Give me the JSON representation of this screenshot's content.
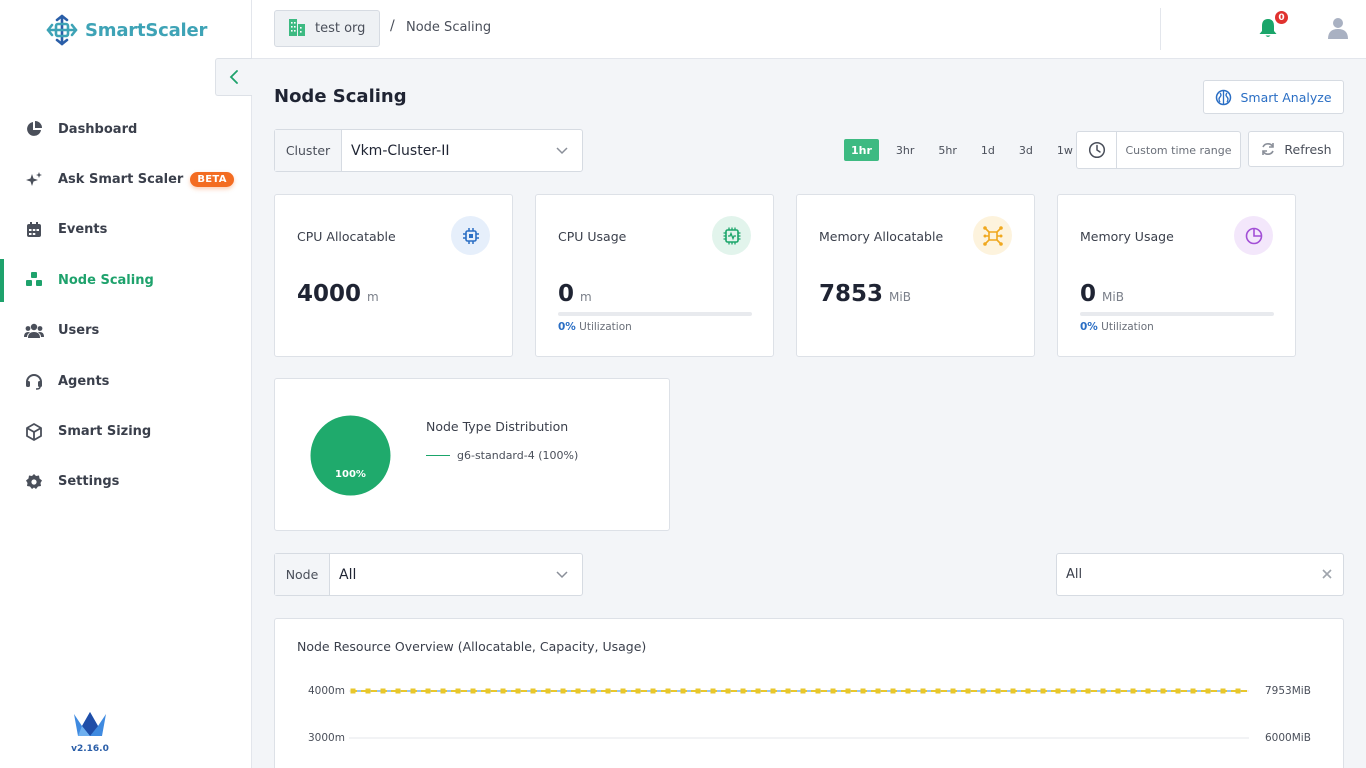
{
  "brand": {
    "name": "SmartScaler",
    "version": "v2.16.0",
    "accent": "#1ea26c"
  },
  "sidebar": {
    "items": [
      {
        "label": "Dashboard",
        "icon": "pie-chart-icon",
        "active": false
      },
      {
        "label": "Ask Smart Scaler",
        "icon": "sparkle-icon",
        "badge": "BETA",
        "active": false
      },
      {
        "label": "Events",
        "icon": "calendar-icon",
        "active": false
      },
      {
        "label": "Node Scaling",
        "icon": "cubes-icon",
        "active": true
      },
      {
        "label": "Users",
        "icon": "users-icon",
        "active": false
      },
      {
        "label": "Agents",
        "icon": "headset-icon",
        "active": false
      },
      {
        "label": "Smart Sizing",
        "icon": "box-icon",
        "active": false
      },
      {
        "label": "Settings",
        "icon": "gear-icon",
        "active": false
      }
    ]
  },
  "header": {
    "org": "test org",
    "breadcrumb_sep": "/",
    "breadcrumb": "Node Scaling",
    "notifications": "0"
  },
  "main": {
    "title": "Node Scaling",
    "smart_analyze": "Smart Analyze",
    "cluster": {
      "label": "Cluster",
      "value": "Vkm-Cluster-II"
    },
    "time_ranges": [
      "1hr",
      "3hr",
      "5hr",
      "1d",
      "3d",
      "1w"
    ],
    "active_range": "1hr",
    "custom_range": "Custom time range",
    "refresh": "Refresh",
    "stats": [
      {
        "title": "CPU Allocatable",
        "value": "4000",
        "unit": "m",
        "icon": "cpu-icon",
        "color": "#2a6ec4"
      },
      {
        "title": "CPU Usage",
        "value": "0",
        "unit": "m",
        "icon": "cpu-pulse-icon",
        "color": "#1aa56a",
        "util_pct": "0%",
        "util_label": "Utilization",
        "util": 0
      },
      {
        "title": "Memory Allocatable",
        "value": "7853",
        "unit": "MiB",
        "icon": "memory-icon",
        "color": "#f0a81e"
      },
      {
        "title": "Memory Usage",
        "value": "0",
        "unit": "MiB",
        "icon": "pie-chart-icon",
        "color": "#a24fd6",
        "util_pct": "0%",
        "util_label": "Utilization",
        "util": 0
      }
    ],
    "distribution": {
      "title": "Node Type Distribution",
      "legend": "g6-standard-4 (100%)",
      "slice_label": "100%",
      "color": "#1faa6c"
    },
    "node_filter": {
      "label": "Node",
      "value": "All"
    },
    "filter_input": {
      "value": "All"
    },
    "overview": {
      "title": "Node Resource Overview (Allocatable, Capacity, Usage)",
      "left_ticks": [
        "4000m",
        "3000m"
      ],
      "right_ticks": [
        "7953MiB",
        "6000MiB"
      ]
    }
  }
}
